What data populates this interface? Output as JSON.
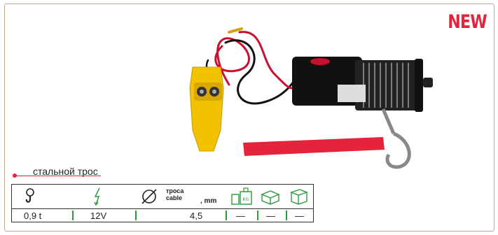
{
  "badge": {
    "label": "NEW"
  },
  "product": {
    "caption": "стальной трос"
  },
  "specs": {
    "icons": [
      "hook-load-icon",
      "voltage-icon",
      "diameter-icon",
      "weight-kg-icon",
      "box-icon",
      "package-icon"
    ],
    "cable_label_line1": "троса",
    "cable_label_line2": "cable",
    "unit_label": ", mm",
    "load": "0,9 t",
    "voltage": "12V",
    "cable_diameter": "4,5",
    "weight": "—",
    "box": "—",
    "package": "—"
  },
  "colors": {
    "accent": "#e5243b",
    "separator": "#2a9a3c"
  }
}
